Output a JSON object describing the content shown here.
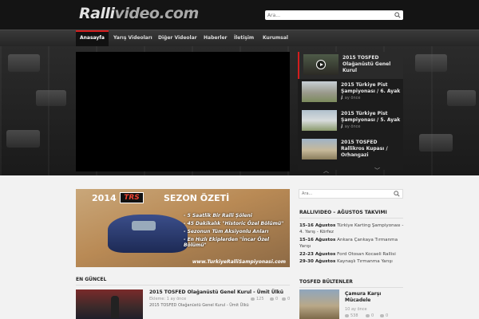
{
  "header": {
    "logo_part1": "Ralli",
    "logo_part2": "video.com",
    "search_placeholder": "Ara..."
  },
  "nav": {
    "items": [
      {
        "label": "Anasayfa",
        "active": true
      },
      {
        "label": "Yarış Videoları"
      },
      {
        "label": "Diğer Videolar"
      },
      {
        "label": "Haberler"
      },
      {
        "label": "İletişim"
      },
      {
        "label": "Kurumsal"
      }
    ]
  },
  "playlist": {
    "items": [
      {
        "title": "2015 TOSFED Olağanüstü Genel Kurul",
        "time": "1 ay önce"
      },
      {
        "title": "2015 Türkiye Pist Şampiyonası / 6. Ayak /",
        "time": "1 ay önce"
      },
      {
        "title": "2015 Türkiye Pist Şampiyonası / 5. Ayak /",
        "time": "1 ay önce"
      },
      {
        "title": "2015 TOSFED Rallikros Kupası / Orhangazi",
        "time": "1 ay önce"
      }
    ],
    "prev_icon": "chevron-up-icon",
    "next_icon": "chevron-down-icon"
  },
  "banner": {
    "year": "2014",
    "brand": "TRS",
    "headline": "SEZON ÖZETİ",
    "bullets": [
      "- 5 Saatlik Bir Ralli Şöleni",
      "- 45 Dakikalık \"Historic Özel Bölümü\"",
      "- Sezonun Tüm Aksiyonlu Anları",
      "- En Hızlı Ekiplerden \"İncar Özel Bölümü\""
    ],
    "url": "www.TurkiyeRalliSampiyonasi.com"
  },
  "latest": {
    "heading": "EN GÜNCEL",
    "item": {
      "title": "2015 TOSFED Olağanüstü Genel Kurul - Ümit Ülkü",
      "date": "Ekleme: 1 ay önce",
      "views": "125",
      "comments": "0",
      "desc": "2015 TOSFED Olağanüstü Genel Kurul - Ümit Ülkü",
      "likes": "0"
    }
  },
  "sidebar": {
    "search_placeholder": "Ara...",
    "calendar": {
      "heading": "RALLIVIDEO – AĞUSTOS TAKVIMI",
      "rows": [
        {
          "date": "15-16 Ağustos",
          "event": "Türkiye Karting Şampiyonası - 4. Yarış - Körfez"
        },
        {
          "date": "15-16 Ağustos",
          "event": "Ankara Çankaya Tırmanma Yarışı"
        },
        {
          "date": "22-23 Ağustos",
          "event": "Ford Otosan Kocaeli Rallisi"
        },
        {
          "date": "29-30 Ağustos",
          "event": "Kaynaşlı Tırmanma Yarışı"
        }
      ]
    },
    "bulletins": {
      "heading": "TOSFED BÜLTENLER",
      "item": {
        "title": "Çamura Karşı Mücadele",
        "date": "10 ay önce",
        "views": "538",
        "comments": "0",
        "likes": "0"
      }
    }
  },
  "colors": {
    "accent": "#d21d1d",
    "header_bg": "#141414",
    "nav_bg": "#2e2e2e"
  }
}
